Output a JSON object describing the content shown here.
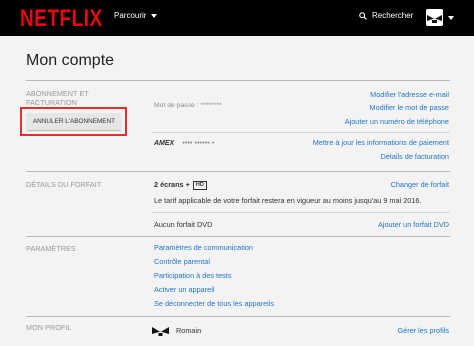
{
  "header": {
    "logo": "NETFLIX",
    "browse_label": "Parcourir",
    "search_label": "Rechercher",
    "icons": [
      "search-icon",
      "chevron-down-icon"
    ]
  },
  "page": {
    "title": "Mon compte"
  },
  "membership": {
    "label": "ABONNEMENT ET FACTURATION",
    "cancel_button": "ANNULER L'ABONNEMENT",
    "email_link": "Modifier l'adresse e-mail",
    "password_label": "Mot de passe : ********",
    "password_link": "Modifier le mot de passe",
    "phone_link": "Ajouter un numéro de téléphone",
    "card_brand": "AMEX",
    "card_mask": "•••• •••••• •",
    "payment_link": "Mettre à jour les informations de paiement",
    "billing_link": "Détails de facturation"
  },
  "plan": {
    "label": "DÉTAILS DU FORFAIT",
    "screens": "2 écrans +",
    "hd_badge": "HD",
    "change_link": "Changer de forfait",
    "notice": "Le tarif applicable de votre forfait restera en vigueur au moins jusqu'au 9 mai 2016.",
    "dvd_text": "Aucun forfait DVD",
    "dvd_link": "Ajouter un forfait DVD"
  },
  "settings": {
    "label": "PARAMÈTRES",
    "links": [
      "Paramètres de communication",
      "Contrôle parental",
      "Participation à des tests",
      "Activer un appareil",
      "Se déconnecter de tous les appareils"
    ]
  },
  "profile": {
    "label": "MON PROFIL",
    "name": "Romain",
    "manage_link": "Gérer les profils"
  },
  "colors": {
    "brand_red": "#e50914",
    "link_blue": "#1f75c9",
    "highlight_red": "#e3302f"
  }
}
